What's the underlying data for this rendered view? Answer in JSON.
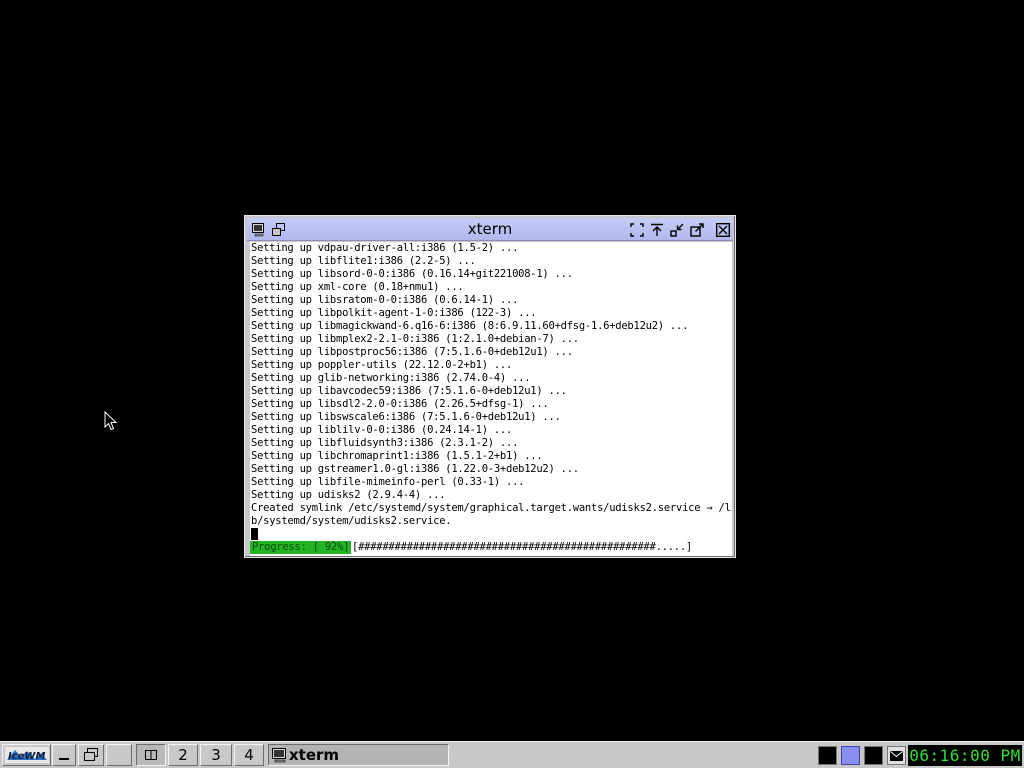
{
  "window": {
    "title": "xterm"
  },
  "terminal": {
    "lines": [
      "Setting up vdpau-driver-all:i386 (1.5-2) ...",
      "Setting up libflite1:i386 (2.2-5) ...",
      "Setting up libsord-0-0:i386 (0.16.14+git221008-1) ...",
      "Setting up xml-core (0.18+nmu1) ...",
      "Setting up libsratom-0-0:i386 (0.6.14-1) ...",
      "Setting up libpolkit-agent-1-0:i386 (122-3) ...",
      "Setting up libmagickwand-6.q16-6:i386 (8:6.9.11.60+dfsg-1.6+deb12u2) ...",
      "Setting up libmplex2-2.1-0:i386 (1:2.1.0+debian-7) ...",
      "Setting up libpostproc56:i386 (7:5.1.6-0+deb12u1) ...",
      "Setting up poppler-utils (22.12.0-2+b1) ...",
      "Setting up glib-networking:i386 (2.74.0-4) ...",
      "Setting up libavcodec59:i386 (7:5.1.6-0+deb12u1) ...",
      "Setting up libsdl2-2.0-0:i386 (2.26.5+dfsg-1) ...",
      "Setting up libswscale6:i386 (7:5.1.6-0+deb12u1) ...",
      "Setting up liblilv-0-0:i386 (0.24.14-1) ...",
      "Setting up libfluidsynth3:i386 (2.3.1-2) ...",
      "Setting up libchromaprint1:i386 (1.5.1-2+b1) ...",
      "Setting up gstreamer1.0-gl:i386 (1.22.0-3+deb12u2) ...",
      "Setting up libfile-mimeinfo-perl (0.33-1) ...",
      "Setting up udisks2 (2.9.4-4) ...",
      "Created symlink /etc/systemd/system/graphical.target.wants/udisks2.service → /li",
      "b/systemd/system/udisks2.service."
    ],
    "progress_label": "Progress: [ 92%]",
    "progress_bar": "[#################################################.....]",
    "progress_percent": 92
  },
  "taskbar": {
    "start_label": "IceWM",
    "workspaces": [
      "1",
      "2",
      "3",
      "4"
    ],
    "active_task": "xterm",
    "clock": "06:16:00 PM"
  },
  "colors": {
    "title_bar": "#b8bdf0",
    "progress_fill": "#22b422",
    "clock_text": "#2ee02e",
    "tray_blue": "#8a8ef0"
  }
}
